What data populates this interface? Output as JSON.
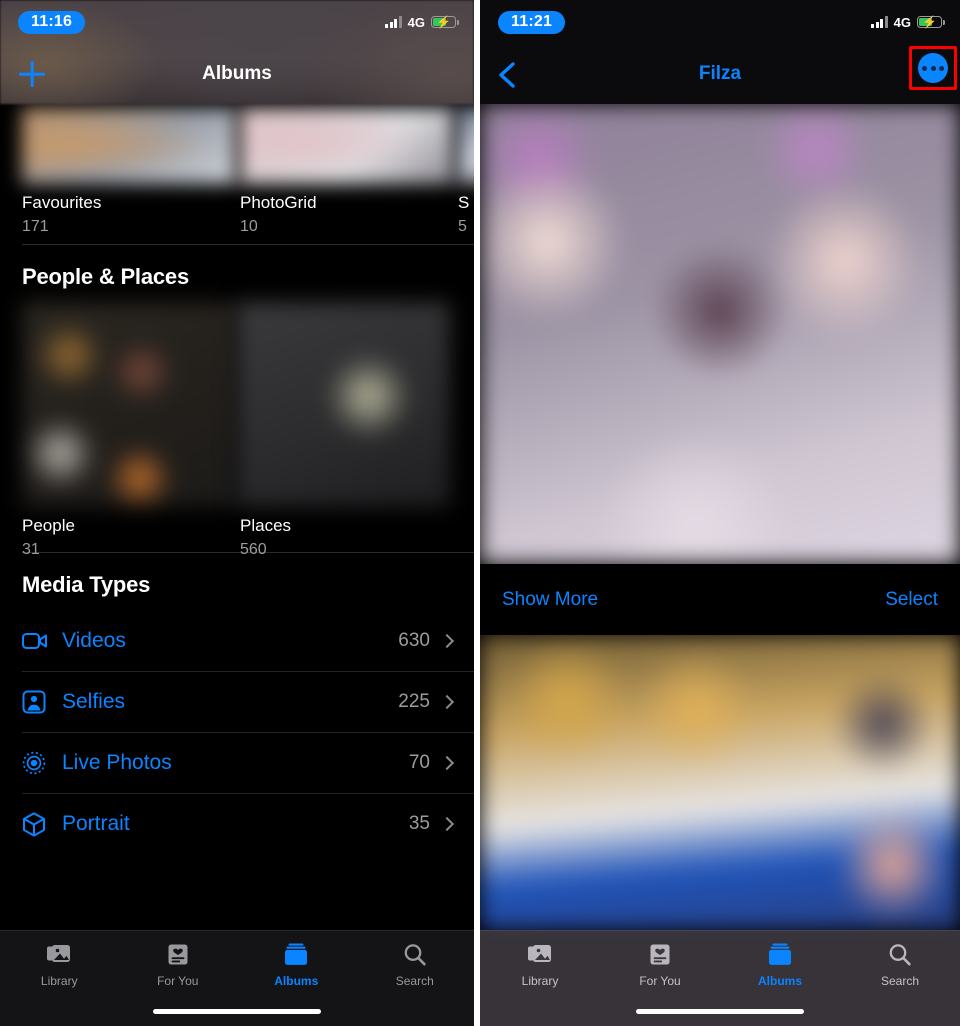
{
  "left_phone": {
    "status": {
      "time": "11:16",
      "network": "4G",
      "signal_icon": "signal-bars-icon",
      "battery_icon": "battery-charging-icon"
    },
    "navbar": {
      "add_icon": "plus-icon",
      "title": "Albums"
    },
    "my_albums": [
      {
        "name": "Favourites",
        "count": "171"
      },
      {
        "name": "PhotoGrid",
        "count": "10"
      },
      {
        "name": "S",
        "count": "5"
      }
    ],
    "people_places": {
      "section_title": "People & Places",
      "items": [
        {
          "name": "People",
          "count": "31"
        },
        {
          "name": "Places",
          "count": "560"
        }
      ]
    },
    "media_types": {
      "section_title": "Media Types",
      "rows": [
        {
          "label": "Videos",
          "count": "630",
          "icon": "video-camera-icon"
        },
        {
          "label": "Selfies",
          "count": "225",
          "icon": "selfie-person-icon"
        },
        {
          "label": "Live Photos",
          "count": "70",
          "icon": "live-photo-icon"
        },
        {
          "label": "Portrait",
          "count": "35",
          "icon": "portrait-cube-icon"
        }
      ]
    },
    "tabbar": [
      {
        "label": "Library",
        "icon": "photo-stack-icon",
        "active": false
      },
      {
        "label": "For You",
        "icon": "heart-card-icon",
        "active": false
      },
      {
        "label": "Albums",
        "icon": "albums-book-icon",
        "active": true
      },
      {
        "label": "Search",
        "icon": "magnifier-icon",
        "active": false
      }
    ]
  },
  "right_phone": {
    "status": {
      "time": "11:21",
      "network": "4G",
      "signal_icon": "signal-bars-icon",
      "battery_icon": "battery-charging-icon"
    },
    "navbar": {
      "back_icon": "chevron-left-icon",
      "title": "Filza",
      "more_icon": "ellipsis-circle-icon",
      "highlight_color": "#ff0000"
    },
    "actions": {
      "show_more": "Show More",
      "select": "Select"
    },
    "tabbar": [
      {
        "label": "Library",
        "icon": "photo-stack-icon",
        "active": false
      },
      {
        "label": "For You",
        "icon": "heart-card-icon",
        "active": false
      },
      {
        "label": "Albums",
        "icon": "albums-book-icon",
        "active": true
      },
      {
        "label": "Search",
        "icon": "magnifier-icon",
        "active": false
      }
    ]
  },
  "theme": {
    "accent": "#0a84ff",
    "background": "#000000",
    "secondary_text": "#9c9c9e",
    "highlight": "#ff0000"
  }
}
